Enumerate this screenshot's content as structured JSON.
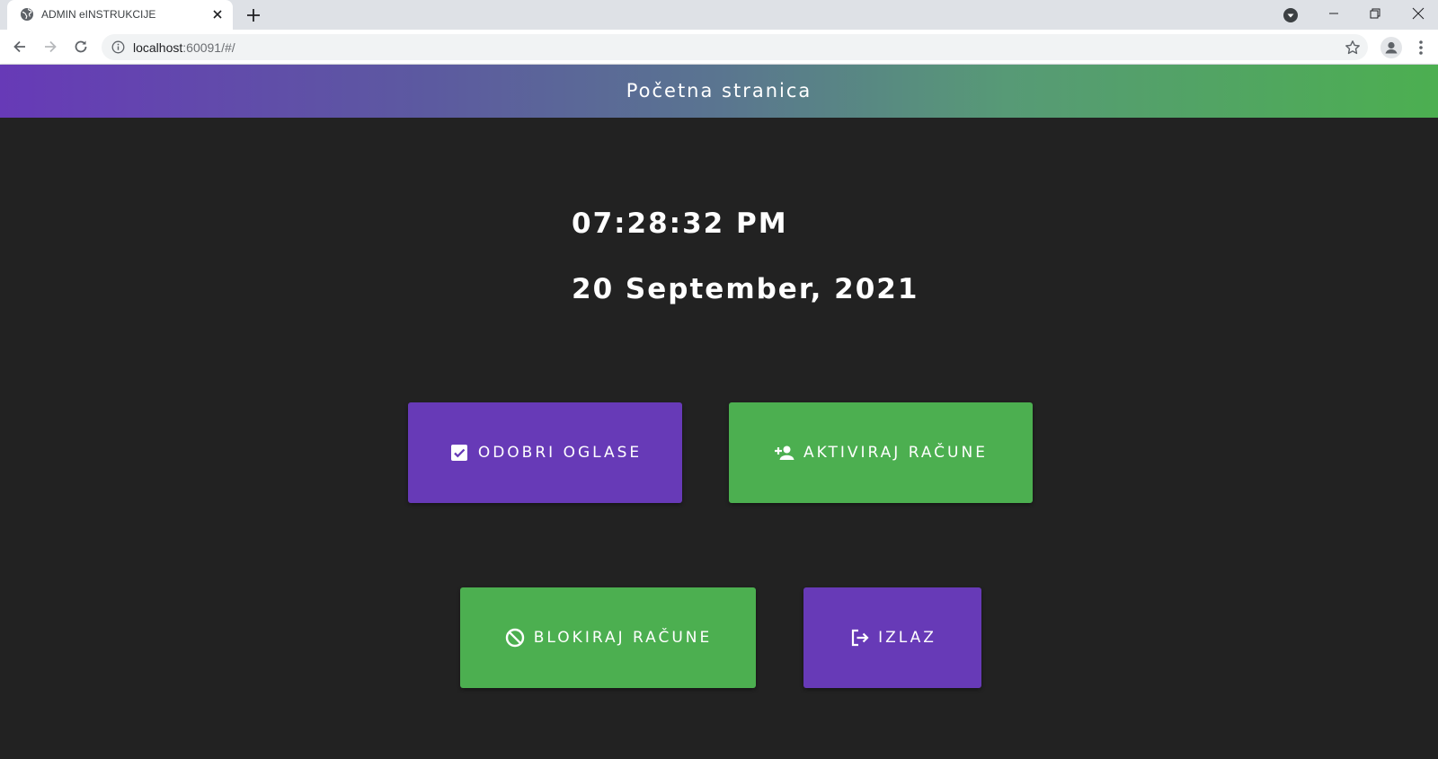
{
  "browser": {
    "tab_title": "ADMIN eINSTRUKCIJE",
    "url_host": "localhost",
    "url_path": ":60091/#/"
  },
  "app": {
    "header_title": "Početna stranica",
    "time": "07:28:32 PM",
    "date": "20 September, 2021"
  },
  "actions": {
    "approve_ads": "ODOBRI OGLASE",
    "activate_accounts": "AKTIVIRAJ RAČUNE",
    "block_accounts": "BLOKIRAJ RAČUNE",
    "logout": "IZLAZ"
  },
  "colors": {
    "primary_purple": "#673ab7",
    "accent_green": "#4caf50",
    "background": "#222222"
  },
  "icons": [
    "globe-icon",
    "close-icon",
    "plus-icon",
    "checkbox-checked-icon",
    "person-add-icon",
    "block-icon",
    "logout-icon"
  ]
}
